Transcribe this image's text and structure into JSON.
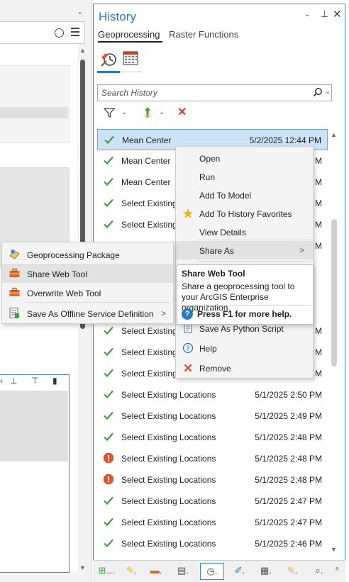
{
  "colors": {
    "accent": "#2a7ac0",
    "success": "#3aa23a",
    "error": "#e0532f",
    "selected_bg": "#cde3f5",
    "favorite_star": "#f2b31b"
  },
  "history": {
    "title": "History",
    "controls": {
      "chevron": "⌄",
      "pin": "⊕",
      "close": "✕"
    },
    "tabs": [
      {
        "label": "Geoprocessing",
        "active": true
      },
      {
        "label": "Raster Functions",
        "active": false
      }
    ],
    "view_icons": [
      "history-clock-icon",
      "calendar-icon"
    ],
    "search": {
      "placeholder": "Search History",
      "value": ""
    },
    "toolbar": {
      "filter_icon": "filter-icon",
      "sort_icon": "sort-icon",
      "clear_icon": "✕"
    },
    "items": [
      {
        "name": "Mean Center",
        "date": "5/2/2025 12:44 PM",
        "status": "success",
        "selected": true
      },
      {
        "name": "Mean Center",
        "date": "M",
        "status": "success"
      },
      {
        "name": "Mean Center",
        "date": "M",
        "status": "success"
      },
      {
        "name": "Select Existing",
        "date": "M",
        "status": "success"
      },
      {
        "name": "Select Existing",
        "date": "M",
        "status": "success"
      },
      {
        "name": "",
        "date": "M",
        "status": "none"
      },
      {
        "name": "",
        "date": "",
        "status": "none"
      },
      {
        "name": "",
        "date": "",
        "status": "none"
      },
      {
        "name": "",
        "date": "",
        "status": "none"
      },
      {
        "name": "Select Existing",
        "date": "M",
        "status": "success"
      },
      {
        "name": "Select Existing",
        "date": "M",
        "status": "success"
      },
      {
        "name": "Select Existing",
        "date": "M",
        "status": "success"
      },
      {
        "name": "Select Existing Locations",
        "date": "5/1/2025 2:50 PM",
        "status": "success"
      },
      {
        "name": "Select Existing Locations",
        "date": "5/1/2025 2:49 PM",
        "status": "success"
      },
      {
        "name": "Select Existing Locations",
        "date": "5/1/2025 2:48 PM",
        "status": "success"
      },
      {
        "name": "Select Existing Locations",
        "date": "5/1/2025 2:48 PM",
        "status": "error"
      },
      {
        "name": "Select Existing Locations",
        "date": "5/1/2025 2:48 PM",
        "status": "error"
      },
      {
        "name": "Select Existing Locations",
        "date": "5/1/2025 2:47 PM",
        "status": "success"
      },
      {
        "name": "Select Existing Locations",
        "date": "5/1/2025 2:47 PM",
        "status": "success"
      },
      {
        "name": "Select Existing Locations",
        "date": "5/1/2025 2:46 PM",
        "status": "success"
      }
    ]
  },
  "context_menu": {
    "items": [
      {
        "label": "Open"
      },
      {
        "label": "Run"
      },
      {
        "label": "Add To Model"
      },
      {
        "label": "Add To History Favorites",
        "icon": "star-icon"
      },
      {
        "label": "View Details"
      },
      {
        "label": "Share As",
        "icon": "",
        "submenu": true
      },
      {
        "label": "Save As Python Script",
        "icon": "python-script-icon"
      },
      {
        "label": "Help",
        "icon": "help-icon"
      },
      {
        "label": "Remove",
        "icon": "remove-icon"
      }
    ],
    "submenu_arrow": ">"
  },
  "share_submenu": {
    "items": [
      {
        "label": "Geoprocessing Package",
        "icon": "geoprocessing-package-icon"
      },
      {
        "label": "Share Web Tool",
        "icon": "share-web-tool-icon",
        "hover": true
      },
      {
        "label": "Overwrite Web Tool",
        "icon": "overwrite-web-tool-icon"
      },
      {
        "label": "Save As Offline Service Definition",
        "icon": "offline-service-definition-icon",
        "submenu": true
      }
    ]
  },
  "tooltip": {
    "title": "Share Web Tool",
    "description": "Share a geoprocessing tool to your ArcGIS Enterprise organization.",
    "help": "Press F1 for more help."
  },
  "bottom_tabs": [
    {
      "icon": "catalog-icon",
      "label": "…"
    },
    {
      "icon": "symbology-icon",
      "label": "."
    },
    {
      "icon": "toolbox-icon",
      "label": "."
    },
    {
      "icon": "element-icon",
      "label": "."
    },
    {
      "icon": "history-clock-icon",
      "label": ".",
      "active": true
    },
    {
      "icon": "edit-icon",
      "label": "."
    },
    {
      "icon": "attributes-icon",
      "label": "."
    },
    {
      "icon": "create-features-icon",
      "label": "."
    },
    {
      "icon": "locate-icon",
      "label": "."
    }
  ]
}
